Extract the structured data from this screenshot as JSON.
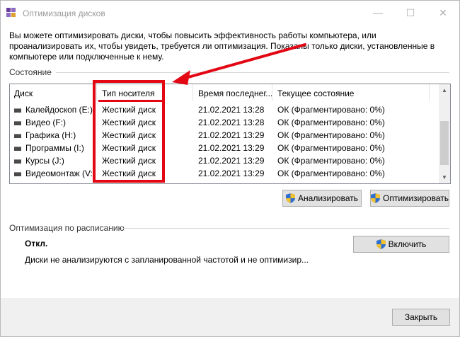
{
  "window": {
    "title": "Оптимизация дисков",
    "controls": {
      "minimize": "—",
      "maximize": "☐",
      "close": "✕"
    }
  },
  "intro_text": "Вы можете оптимизировать диски, чтобы повысить эффективность работы компьютера, или проанализировать их, чтобы увидеть, требуется ли оптимизация. Показаны только диски, установленные в компьютере или подключенные к нему.",
  "status_section": {
    "label": "Состояние",
    "columns": [
      "Диск",
      "Тип носителя",
      "Время последнег...",
      "Текущее состояние"
    ],
    "rows": [
      {
        "drive": "Калейдоскоп (E:)",
        "media": "Жесткий диск",
        "time": "21.02.2021 13:28",
        "state": "ОК (Фрагментировано: 0%)"
      },
      {
        "drive": "Видео (F:)",
        "media": "Жесткий диск",
        "time": "21.02.2021 13:28",
        "state": "ОК (Фрагментировано: 0%)"
      },
      {
        "drive": "Графика (H:)",
        "media": "Жесткий диск",
        "time": "21.02.2021 13:29",
        "state": "ОК (Фрагментировано: 0%)"
      },
      {
        "drive": "Программы (I:)",
        "media": "Жесткий диск",
        "time": "21.02.2021 13:29",
        "state": "ОК (Фрагментировано: 0%)"
      },
      {
        "drive": "Курсы (J:)",
        "media": "Жесткий диск",
        "time": "21.02.2021 13:29",
        "state": "ОК (Фрагментировано: 0%)"
      },
      {
        "drive": "Видеомонтаж (V:)",
        "media": "Жесткий диск",
        "time": "21.02.2021 13:29",
        "state": "ОК (Фрагментировано: 0%)"
      }
    ],
    "analyze_label": "Анализировать",
    "optimize_label": "Оптимизировать"
  },
  "schedule_section": {
    "label": "Оптимизация по расписанию",
    "status": "Откл.",
    "description": "Диски не анализируются с запланированной частотой и не оптимизир...",
    "enable_label": "Включить"
  },
  "footer": {
    "close_label": "Закрыть"
  },
  "colors": {
    "annotation": "#e30613",
    "button_bg": "#e1e1e1",
    "footer_bg": "#f0f0f0"
  },
  "icons": {
    "app": "defrag-app-icon",
    "drive": "hard-drive-icon",
    "shield": "uac-shield-icon"
  }
}
